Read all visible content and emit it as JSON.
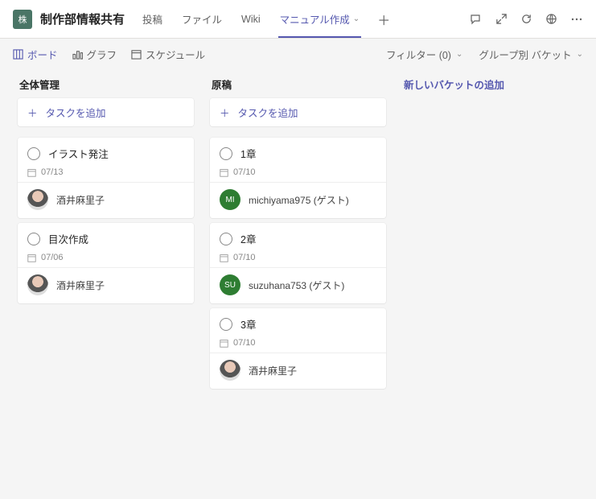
{
  "header": {
    "team_initial": "株",
    "team_title": "制作部情報共有",
    "tabs": [
      "投稿",
      "ファイル",
      "Wiki",
      "マニュアル作成"
    ],
    "active_tab": "マニュアル作成"
  },
  "toolbar": {
    "views": {
      "board": "ボード",
      "chart": "グラフ",
      "schedule": "スケジュール"
    },
    "filter_label": "フィルター (0)",
    "group_label": "グループ別 バケット"
  },
  "board": {
    "add_bucket_label": "新しいバケットの追加",
    "add_task_label": "タスクを追加",
    "columns": [
      {
        "title": "全体管理",
        "cards": [
          {
            "title": "イラスト発注",
            "date": "07/13",
            "assignee": "酒井麻里子",
            "avatar": "person"
          },
          {
            "title": "目次作成",
            "date": "07/06",
            "assignee": "酒井麻里子",
            "avatar": "person"
          }
        ]
      },
      {
        "title": "原稿",
        "cards": [
          {
            "title": "1章",
            "date": "07/10",
            "assignee": "michiyama975 (ゲスト)",
            "avatar": "mi",
            "initials": "MI"
          },
          {
            "title": "2章",
            "date": "07/10",
            "assignee": "suzuhana753 (ゲスト)",
            "avatar": "su",
            "initials": "SU"
          },
          {
            "title": "3章",
            "date": "07/10",
            "assignee": "酒井麻里子",
            "avatar": "person"
          }
        ]
      }
    ]
  }
}
